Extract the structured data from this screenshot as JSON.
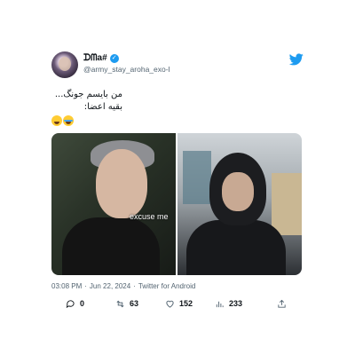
{
  "author": {
    "display_name": "ᗪᗰa#",
    "handle": "@army_stay_aroha_exo-l",
    "verified": true
  },
  "tweet": {
    "lines": [
      "من بایسم جونگ...",
      "بقیه اعضا:"
    ],
    "emojis": [
      "grinning-sweat-emoji",
      "crying-face-emoji"
    ]
  },
  "media": {
    "caption": "excuse me"
  },
  "meta": {
    "time": "03:08 PM",
    "separator": "·",
    "date": "Jun 22, 2024",
    "client": "Twitter for Android"
  },
  "stats": {
    "replies": "0",
    "retweets": "63",
    "likes": "152",
    "views": "233"
  },
  "colors": {
    "brand": "#1d9bf0",
    "secondary_text": "#536471",
    "primary_text": "#0f1419"
  }
}
